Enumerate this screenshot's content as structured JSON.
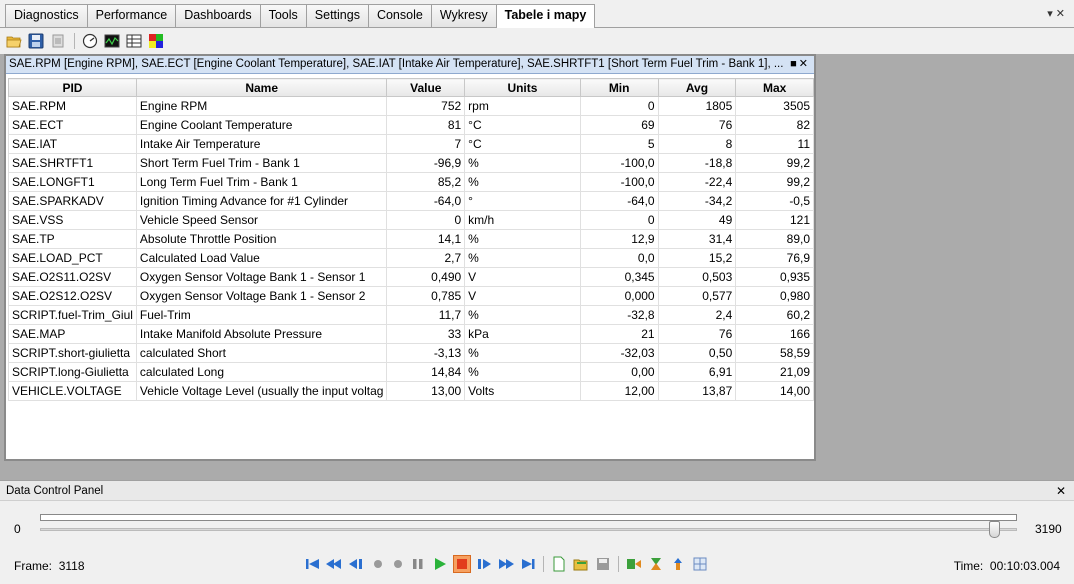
{
  "tabs": [
    {
      "label": "Diagnostics"
    },
    {
      "label": "Performance"
    },
    {
      "label": "Dashboards"
    },
    {
      "label": "Tools"
    },
    {
      "label": "Settings"
    },
    {
      "label": "Console"
    },
    {
      "label": "Wykresy"
    },
    {
      "label": "Tabele i mapy",
      "active": true
    }
  ],
  "toolbar": {
    "icons": [
      "open-folder-icon",
      "save-icon",
      "export-icon",
      "gauge-icon",
      "oscilloscope-icon",
      "table-icon",
      "map-icon"
    ]
  },
  "table_window": {
    "title": "SAE.RPM [Engine RPM], SAE.ECT [Engine Coolant Temperature], SAE.IAT [Intake Air Temperature], SAE.SHRTFT1 [Short Term Fuel Trim - Bank 1], ...",
    "columns": [
      "PID",
      "Name",
      "Value",
      "Units",
      "Min",
      "Avg",
      "Max"
    ],
    "rows": [
      [
        "SAE.RPM",
        "Engine RPM",
        "752",
        "rpm",
        "0",
        "1805",
        "3505"
      ],
      [
        "SAE.ECT",
        "Engine Coolant Temperature",
        "81",
        "°C",
        "69",
        "76",
        "82"
      ],
      [
        "SAE.IAT",
        "Intake Air Temperature",
        "7",
        "°C",
        "5",
        "8",
        "11"
      ],
      [
        "SAE.SHRTFT1",
        "Short Term Fuel Trim - Bank 1",
        "-96,9",
        "%",
        "-100,0",
        "-18,8",
        "99,2"
      ],
      [
        "SAE.LONGFT1",
        "Long Term Fuel Trim - Bank 1",
        "85,2",
        "%",
        "-100,0",
        "-22,4",
        "99,2"
      ],
      [
        "SAE.SPARKADV",
        "Ignition Timing Advance for #1 Cylinder",
        "-64,0",
        "°",
        "-64,0",
        "-34,2",
        "-0,5"
      ],
      [
        "SAE.VSS",
        "Vehicle Speed Sensor",
        "0",
        "km/h",
        "0",
        "49",
        "121"
      ],
      [
        "SAE.TP",
        "Absolute Throttle Position",
        "14,1",
        "%",
        "12,9",
        "31,4",
        "89,0"
      ],
      [
        "SAE.LOAD_PCT",
        "Calculated Load Value",
        "2,7",
        "%",
        "0,0",
        "15,2",
        "76,9"
      ],
      [
        "SAE.O2S11.O2SV",
        "Oxygen Sensor Voltage Bank 1 - Sensor 1",
        "0,490",
        "V",
        "0,345",
        "0,503",
        "0,935"
      ],
      [
        "SAE.O2S12.O2SV",
        "Oxygen Sensor Voltage Bank 1 - Sensor 2",
        "0,785",
        "V",
        "0,000",
        "0,577",
        "0,980"
      ],
      [
        "SCRIPT.fuel-Trim_Giul",
        "Fuel-Trim",
        "11,7",
        "%",
        "-32,8",
        "2,4",
        "60,2"
      ],
      [
        "SAE.MAP",
        "Intake Manifold Absolute Pressure",
        "33",
        "kPa",
        "21",
        "76",
        "166"
      ],
      [
        "SCRIPT.short-giulietta",
        "calculated Short",
        "-3,13",
        "%",
        "-32,03",
        "0,50",
        "58,59"
      ],
      [
        "SCRIPT.long-Giulietta",
        "calculated Long",
        "14,84",
        "%",
        "0,00",
        "6,91",
        "21,09"
      ],
      [
        "VEHICLE.VOLTAGE",
        "Vehicle Voltage Level (usually the input voltag",
        "13,00",
        "Volts",
        "12,00",
        "13,87",
        "14,00"
      ]
    ]
  },
  "data_control_panel": {
    "title": "Data Control Panel",
    "slider_min": "0",
    "slider_max": "3190",
    "slider_fraction": 0.977,
    "frame_label": "Frame:",
    "frame_value": "3118",
    "time_label": "Time:",
    "time_value": "00:10:03.004"
  },
  "player_controls": [
    "skip-to-start-icon",
    "fast-rewind-icon",
    "step-back-icon",
    "record-dot-icon",
    "record-dot-icon",
    "pause-icon",
    "play-icon",
    "stop-icon",
    "step-forward-icon",
    "fast-forward-icon",
    "skip-to-end-icon",
    "new-file-icon",
    "open-file-icon",
    "save-file-icon",
    "filter-icon",
    "bookmark-icon",
    "marker-icon",
    "settings-grid-icon"
  ]
}
